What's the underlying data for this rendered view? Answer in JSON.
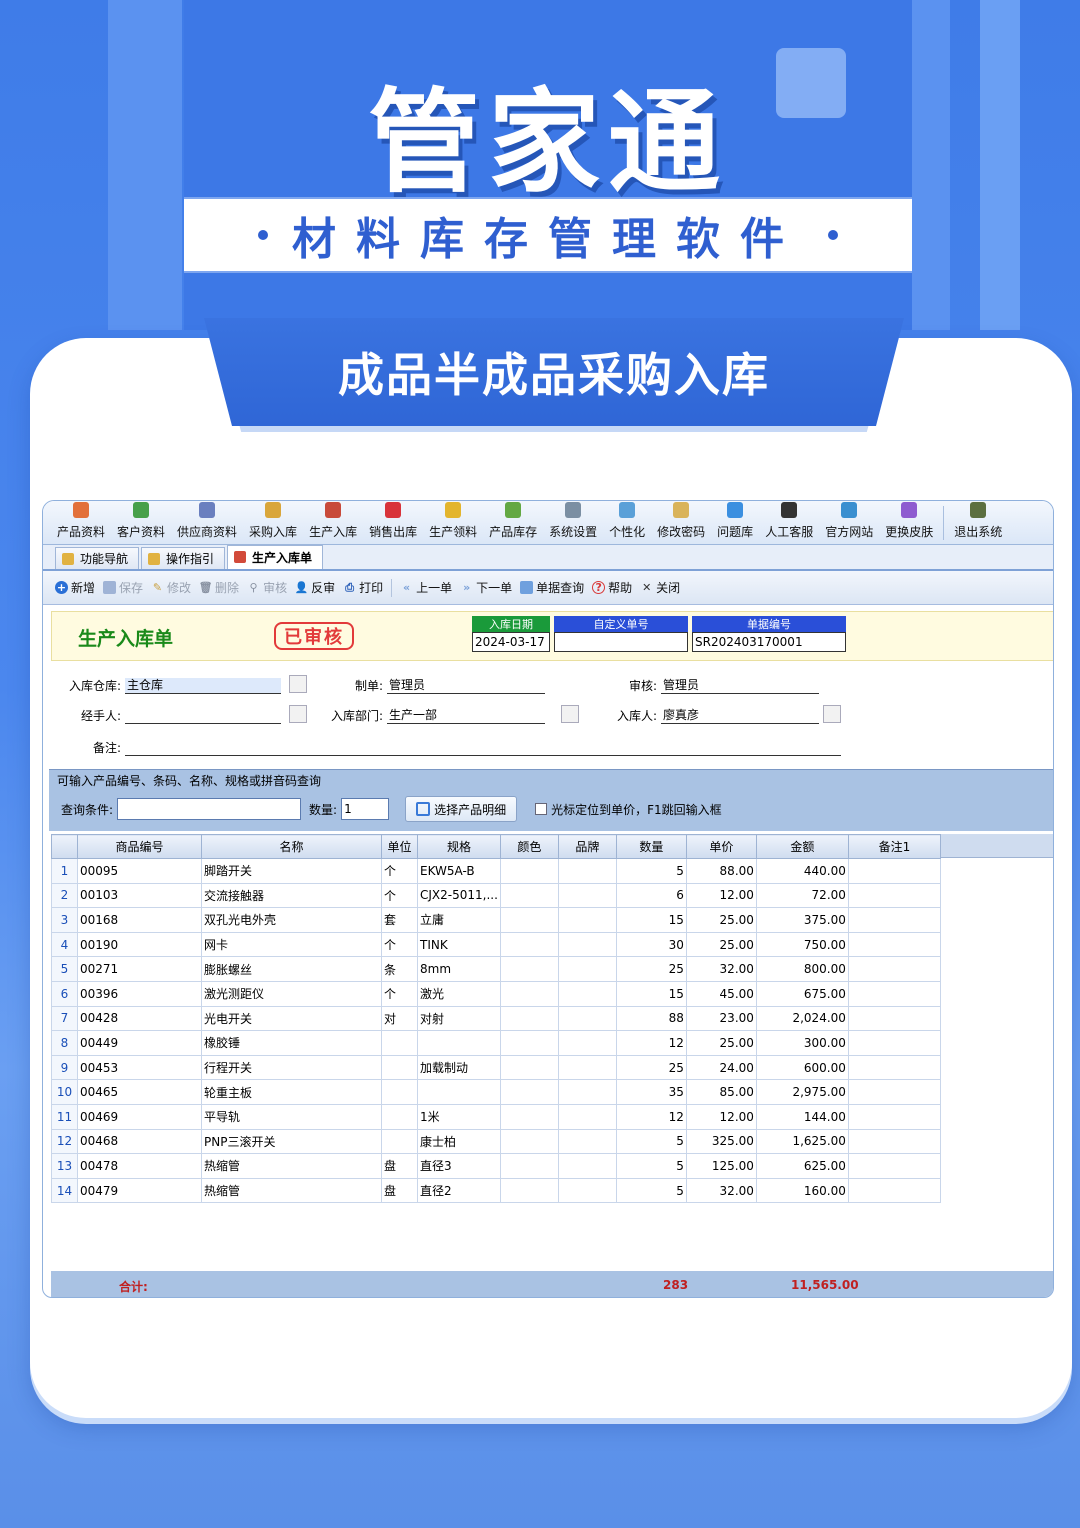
{
  "hero": {
    "title": "管家通",
    "subtitle": "材料库存管理软件",
    "banner": "成品半成品采购入库"
  },
  "menu": [
    {
      "label": "产品资料",
      "icon": "product-icon"
    },
    {
      "label": "客户资料",
      "icon": "customer-icon"
    },
    {
      "label": "供应商资料",
      "icon": "supplier-icon"
    },
    {
      "label": "采购入库",
      "icon": "purchase-icon"
    },
    {
      "label": "生产入库",
      "icon": "production-icon"
    },
    {
      "label": "销售出库",
      "icon": "sales-icon"
    },
    {
      "label": "生产领料",
      "icon": "material-icon"
    },
    {
      "label": "产品库存",
      "icon": "stock-icon"
    },
    {
      "label": "系统设置",
      "icon": "settings-icon"
    },
    {
      "label": "个性化",
      "icon": "personalize-icon"
    },
    {
      "label": "修改密码",
      "icon": "password-icon"
    },
    {
      "label": "问题库",
      "icon": "faq-icon"
    },
    {
      "label": "人工客服",
      "icon": "support-icon"
    },
    {
      "label": "官方网站",
      "icon": "website-icon"
    },
    {
      "label": "更换皮肤",
      "icon": "skin-icon"
    },
    {
      "label": "退出系统",
      "icon": "exit-icon"
    }
  ],
  "tabs": [
    "功能导航",
    "操作指引",
    "生产入库单"
  ],
  "toolbar": {
    "add": "新增",
    "save": "保存",
    "edit": "修改",
    "delete": "删除",
    "audit": "审核",
    "unaudit": "反审",
    "print": "打印",
    "prev": "上一单",
    "next": "下一单",
    "query": "单据查询",
    "help": "帮助",
    "close": "关闭"
  },
  "form": {
    "title": "生产入库单",
    "stamp": "已审核",
    "date_label": "入库日期",
    "date": "2024-03-17",
    "custom_label": "自定义单号",
    "custom": "",
    "no_label": "单据编号",
    "no": "SR202403170001",
    "warehouse_label": "入库仓库:",
    "warehouse": "主仓库",
    "maker_label": "制单:",
    "maker": "管理员",
    "auditor_label": "审核:",
    "auditor": "管理员",
    "handler_label": "经手人:",
    "handler": "",
    "dept_label": "入库部门:",
    "dept": "生产一部",
    "receiver_label": "入库人:",
    "receiver": "廖真彦",
    "remark_label": "备注:",
    "remark": ""
  },
  "query": {
    "legend": "可输入产品编号、条码、名称、规格或拼音码查询",
    "cond_label": "查询条件:",
    "cond": "",
    "qty_label": "数量:",
    "qty": "1",
    "select_btn": "选择产品明细",
    "option": "光标定位到单价，F1跳回输入框"
  },
  "table": {
    "columns": [
      "",
      "商品编号",
      "名称",
      "单位",
      "规格",
      "颜色",
      "品牌",
      "数量",
      "单价",
      "金额",
      "备注1"
    ],
    "rows": [
      [
        "1",
        "00095",
        "脚踏开关",
        "个",
        "EKW5A-B",
        "",
        "",
        "5",
        "88.00",
        "440.00",
        ""
      ],
      [
        "2",
        "00103",
        "交流接触器",
        "个",
        "CJX2-5011,...",
        "",
        "",
        "6",
        "12.00",
        "72.00",
        ""
      ],
      [
        "3",
        "00168",
        "双孔光电外壳",
        "套",
        "立庸",
        "",
        "",
        "15",
        "25.00",
        "375.00",
        ""
      ],
      [
        "4",
        "00190",
        "网卡",
        "个",
        "TINK",
        "",
        "",
        "30",
        "25.00",
        "750.00",
        ""
      ],
      [
        "5",
        "00271",
        "膨胀螺丝",
        "条",
        "8mm",
        "",
        "",
        "25",
        "32.00",
        "800.00",
        ""
      ],
      [
        "6",
        "00396",
        "激光测距仪",
        "个",
        "激光",
        "",
        "",
        "15",
        "45.00",
        "675.00",
        ""
      ],
      [
        "7",
        "00428",
        "光电开关",
        "对",
        "对射",
        "",
        "",
        "88",
        "23.00",
        "2,024.00",
        ""
      ],
      [
        "8",
        "00449",
        "橡胶锤",
        "",
        "",
        "",
        "",
        "12",
        "25.00",
        "300.00",
        ""
      ],
      [
        "9",
        "00453",
        "行程开关",
        "",
        "加载制动",
        "",
        "",
        "25",
        "24.00",
        "600.00",
        ""
      ],
      [
        "10",
        "00465",
        "轮重主板",
        "",
        "",
        "",
        "",
        "35",
        "85.00",
        "2,975.00",
        ""
      ],
      [
        "11",
        "00469",
        "平导轨",
        "",
        "1米",
        "",
        "",
        "12",
        "12.00",
        "144.00",
        ""
      ],
      [
        "12",
        "00468",
        "PNP三滚开关",
        "",
        "康士柏",
        "",
        "",
        "5",
        "325.00",
        "1,625.00",
        ""
      ],
      [
        "13",
        "00478",
        "热缩管",
        "盘",
        "直径3",
        "",
        "",
        "5",
        "125.00",
        "625.00",
        ""
      ],
      [
        "14",
        "00479",
        "热缩管",
        "盘",
        "直径2",
        "",
        "",
        "5",
        "32.00",
        "160.00",
        ""
      ]
    ]
  },
  "footer": {
    "label": "合计:",
    "qty_total": "283",
    "amount_total": "11,565.00"
  }
}
